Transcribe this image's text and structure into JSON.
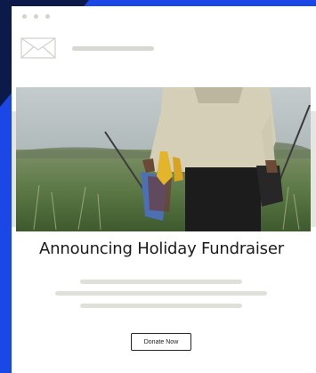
{
  "email": {
    "headline": "Announcing Holiday Fundraiser",
    "cta_label": "Donate Now",
    "icons": {
      "window": "window-dots-icon",
      "mail": "envelope-icon"
    },
    "hero_image": "person-with-bags-in-field-photo"
  },
  "colors": {
    "background": "#1a47e6",
    "card": "#ffffff",
    "placeholder": "#e0e0da"
  }
}
